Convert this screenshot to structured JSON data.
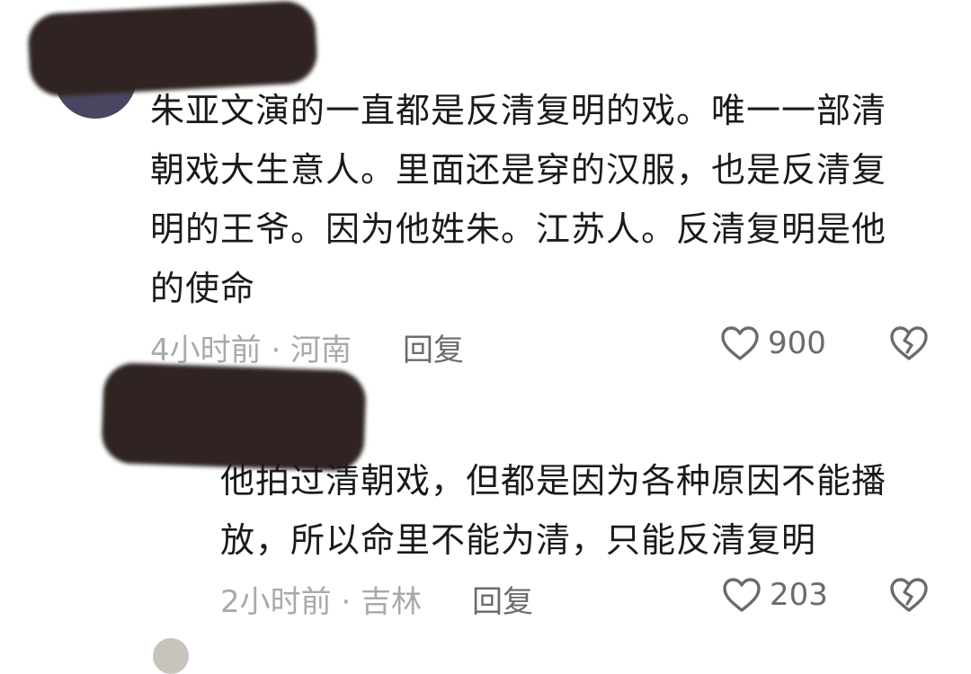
{
  "comments": [
    {
      "text": "朱亚文演的一直都是反清复明的戏。唯一一部清\n朝戏大生意人。里面还是穿的汉服，也是反清复\n明的王爷。因为他姓朱。江苏人。反清复明是他\n的使命",
      "meta": "4小时前 · 河南",
      "reply_label": "回复",
      "likes": "900"
    },
    {
      "text": "他拍过清朝戏，但都是因为各种原因不能播\n放，所以命里不能为清，只能反清复明",
      "meta": "2小时前 · 吉林",
      "reply_label": "回复",
      "likes": "203"
    }
  ],
  "icons": {
    "like": "heart-outline-icon",
    "dislike": "broken-heart-icon"
  },
  "colors": {
    "text": "#1a1a1a",
    "meta": "#a9a9a9",
    "action": "#6b6b6b",
    "redaction": "#2f2422"
  }
}
